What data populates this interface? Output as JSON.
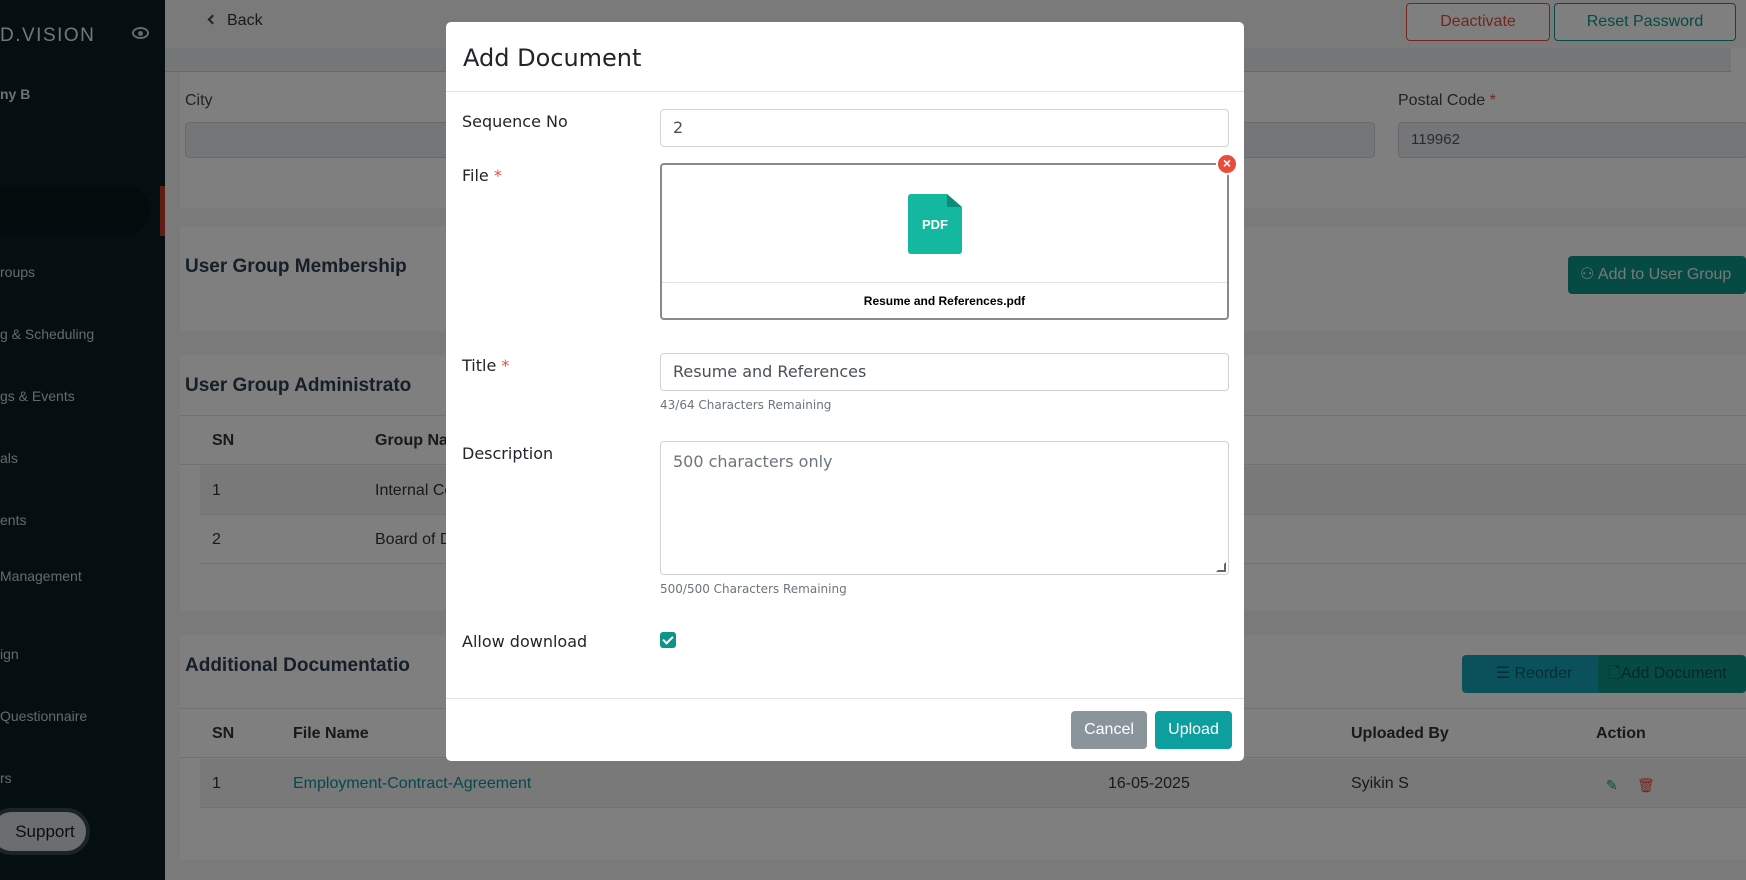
{
  "sidebar": {
    "brand": "D.VISION",
    "user_name": "ny B",
    "items": [
      {
        "label": "roups"
      },
      {
        "label": "g & Scheduling"
      },
      {
        "label": "gs & Events"
      },
      {
        "label": "als"
      },
      {
        "label": "ents"
      },
      {
        "label": " Management"
      },
      {
        "label": "ign"
      },
      {
        "label": " Questionnaire"
      },
      {
        "label": "rs"
      }
    ],
    "support_label": "Support"
  },
  "header": {
    "back_label": "Back",
    "deactivate_label": "Deactivate",
    "reset_password_label": "Reset Password"
  },
  "address": {
    "city_label": "City",
    "postal_label": "Postal Code",
    "required_mark": "*",
    "postal_value": "119962"
  },
  "membership": {
    "title": "User Group Membership",
    "add_button_label": "Add to User Group"
  },
  "admin": {
    "title": "User Group Administrato",
    "columns": [
      "SN",
      "Group Na"
    ],
    "rows": [
      {
        "sn": "1",
        "group": "Internal Co"
      },
      {
        "sn": "2",
        "group": "Board of D"
      }
    ]
  },
  "docs": {
    "title": "Additional Documentatio",
    "reorder_label": "Reorder",
    "add_document_label": "Add Document",
    "columns": [
      "SN",
      "File Name",
      "Uploaded By",
      "Action"
    ],
    "rows": [
      {
        "sn": "1",
        "file_name": "Employment-Contract-Agreement",
        "date": "16-05-2025",
        "uploaded_by": "Syikin S"
      }
    ]
  },
  "modal": {
    "title": "Add Document",
    "sequence_label": "Sequence No",
    "sequence_value": "2",
    "file_label": "File",
    "required_mark": "*",
    "file_icon_text": "PDF",
    "file_name": "Resume and References.pdf",
    "remove_icon": "×",
    "title_label": "Title",
    "title_value": "Resume and References",
    "title_hint": "43/64 Characters Remaining",
    "description_label": "Description",
    "description_placeholder": "500 characters only",
    "description_hint": "500/500 Characters Remaining",
    "allow_download_label": "Allow download",
    "allow_download_checked": true,
    "cancel_label": "Cancel",
    "upload_label": "Upload"
  },
  "colors": {
    "sidebar_bg": "#0a1f25",
    "accent_teal": "#0d9488",
    "danger": "#e74c3c"
  }
}
